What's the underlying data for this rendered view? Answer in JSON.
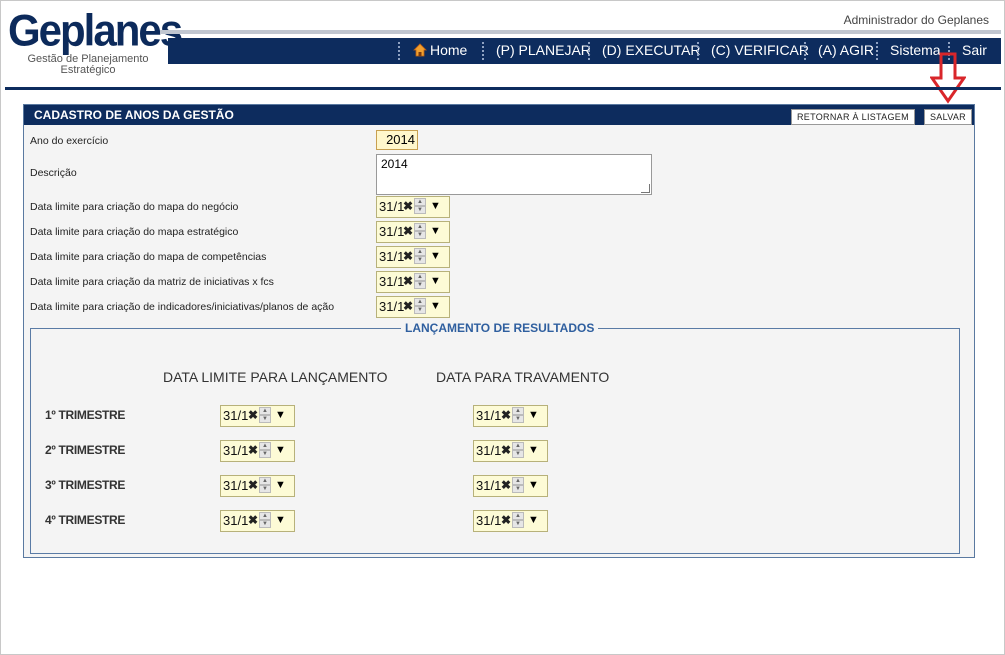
{
  "header": {
    "logo": "Geplanes",
    "logo_sub": "Gestão de Planejamento Estratégico",
    "user": "Administrador do Geplanes"
  },
  "nav": {
    "home": "Home",
    "planejar": "(P) PLANEJAR",
    "executar": "(D) EXECUTAR",
    "verificar": "(C) VERIFICAR",
    "agir": "(A) AGIR",
    "sistema": "Sistema",
    "sair": "Sair"
  },
  "panel": {
    "title": "CADASTRO DE ANOS DA GESTÃO",
    "btn_retornar": "RETORNAR À LISTAGEM",
    "btn_salvar": "SALVAR"
  },
  "form": {
    "ano_label": "Ano do exercício",
    "ano_value": "2014",
    "desc_label": "Descrição",
    "desc_value": "2014",
    "dates": [
      {
        "label": "Data limite para criação do mapa do negócio",
        "value": "31/1"
      },
      {
        "label": "Data limite para criação do mapa estratégico",
        "value": "31/1"
      },
      {
        "label": "Data limite para criação do mapa de competências",
        "value": "31/1"
      },
      {
        "label": "Data limite para criação da matriz de iniciativas x fcs",
        "value": "31/1"
      },
      {
        "label": "Data limite para criação de indicadores/iniciativas/planos de ação",
        "value": "31/1"
      }
    ]
  },
  "resultados": {
    "legend": "LANÇAMENTO DE RESULTADOS",
    "col_limite": "DATA LIMITE PARA LANÇAMENTO",
    "col_travamento": "DATA PARA TRAVAMENTO",
    "rows": [
      {
        "label": "1º TRIMESTRE",
        "limite": "31/1",
        "travamento": "31/1"
      },
      {
        "label": "2º TRIMESTRE",
        "limite": "31/1",
        "travamento": "31/1"
      },
      {
        "label": "3º TRIMESTRE",
        "limite": "31/1",
        "travamento": "31/1"
      },
      {
        "label": "4º TRIMESTRE",
        "limite": "31/1",
        "travamento": "31/1"
      }
    ]
  },
  "colors": {
    "navy": "#0d2c5e",
    "accent_arrow": "#d9262a",
    "field_bg": "#fdfbd6"
  }
}
